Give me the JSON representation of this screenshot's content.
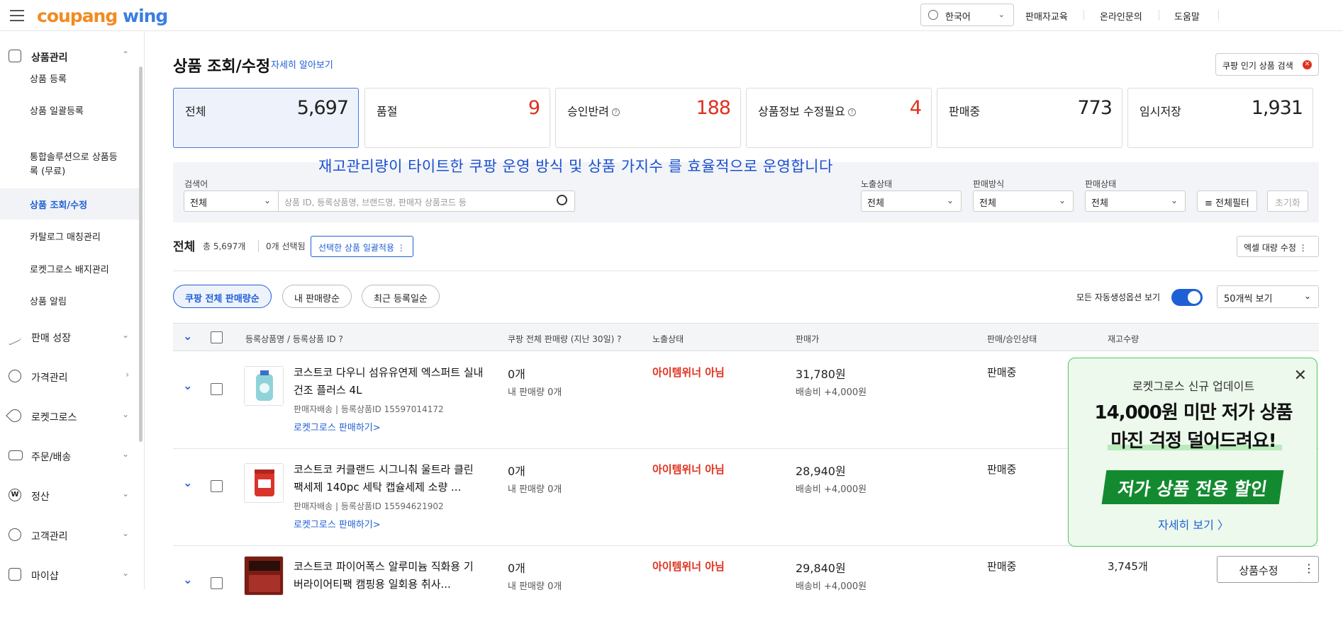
{
  "topbar": {
    "logo_part1": "coupang",
    "logo_part2": " wing",
    "language": "한국어",
    "links": [
      "판매자교육",
      "온라인문의",
      "도움말"
    ]
  },
  "sidebar": {
    "section_products": "상품관리",
    "sub_items": [
      "상품 등록",
      "상품 일괄등록",
      "통합솔루션으로 상품등록 (무료)",
      "상품 조회/수정",
      "카탈로그 매칭관리",
      "로켓그로스 배지관리",
      "상품 알림"
    ],
    "sections": [
      "판매 성장",
      "가격관리",
      "로켓그로스",
      "주문/배송",
      "정산",
      "고객관리",
      "마이샵"
    ]
  },
  "page": {
    "title": "상품 조회/수정",
    "learn_more": "자세히 알아보기",
    "popular_btn": "쿠팡 인기 상품 검색",
    "notice": "재고관리량이  타이트한  쿠팡 운영 방식 및  상품  가지수 를 효율적으로 운영합니다"
  },
  "stats": [
    {
      "label": "전체",
      "value": "5,697",
      "help": false,
      "red": false
    },
    {
      "label": "품절",
      "value": "9",
      "help": false,
      "red": true
    },
    {
      "label": "승인반려",
      "value": "188",
      "help": true,
      "red": true
    },
    {
      "label": "상품정보 수정필요",
      "value": "4",
      "help": true,
      "red": true
    },
    {
      "label": "판매중",
      "value": "773",
      "help": false,
      "red": false
    },
    {
      "label": "임시저장",
      "value": "1,931",
      "help": false,
      "red": false
    }
  ],
  "filters": {
    "search_label": "검색어",
    "search_scope": "전체",
    "search_placeholder": "상품 ID, 등록상품명, 브랜드명, 판매자 상품코드 등",
    "expose_label": "노출상태",
    "expose_value": "전체",
    "method_label": "판매방식",
    "method_value": "전체",
    "status_label": "판매상태",
    "status_value": "전체",
    "all_filter": "전체필터",
    "reset": "초기화"
  },
  "list": {
    "heading": "전체",
    "count": "총 5,697개",
    "selected": "0개 선택됨",
    "bulk_btn": "선택한 상품 일괄적용 ⋮",
    "excel_btn": "엑셀 대량 수정 ⋮",
    "sort_pills": [
      "쿠팡 전체 판매량순",
      "내 판매량순",
      "최근 등록일순"
    ],
    "toggle_label": "모든 자동생성옵션 보기",
    "per_page": "50개씩 보기"
  },
  "table": {
    "headers": [
      "등록상품명 / 등록상품 ID",
      "쿠팡 전체 판매량 (지난 30일)",
      "노출상태",
      "판매가",
      "판매/승인상태",
      "재고수량"
    ],
    "rows": [
      {
        "name": "코스트코 다우니 섬유유연제 엑스퍼트 실내건조 플러스 4L",
        "meta": "판매자배송  |  등록상품ID 15597014172",
        "link": "로켓그로스 판매하기>",
        "sales": "0개",
        "my_sales": "내 판매량 0개",
        "expose": "아이템위너 아님",
        "price": "31,780원",
        "ship": "배송비 +4,000원",
        "status": "판매중",
        "stock": ""
      },
      {
        "name": "코스트코 커클랜드 시그니춰 울트라 클린 팩세제 140pc 세탁 캡슐세제 소량 ...",
        "meta": "판매자배송  |  등록상품ID 15594621902",
        "link": "로켓그로스 판매하기>",
        "sales": "0개",
        "my_sales": "내 판매량 0개",
        "expose": "아이템위너 아님",
        "price": "28,940원",
        "ship": "배송비 +4,000원",
        "status": "판매중",
        "stock": ""
      },
      {
        "name": "코스트코 파이어폭스 알루미늄 직화용 기 버라이어티팩 캠핑용 일회용 취사...",
        "meta": "",
        "link": "",
        "sales": "0개",
        "my_sales": "내 판매량 0개",
        "expose": "아이템위너 아님",
        "price": "29,840원",
        "ship": "배송비 +4,000원",
        "status": "판매중",
        "stock": "3,745개"
      }
    ],
    "edit_btn": "상품수정"
  },
  "promo": {
    "subtitle": "로켓그로스 신규 업데이트",
    "title1": "14,000원 미만 저가 상품",
    "title2": "마진 걱정 덜어드려요!",
    "badge": "저가 상품 전용 할인",
    "link": "자세히 보기  〉"
  },
  "colors": {
    "accent": "#1f5fd6",
    "red": "#e0301e",
    "promo_green": "#138a2f"
  }
}
